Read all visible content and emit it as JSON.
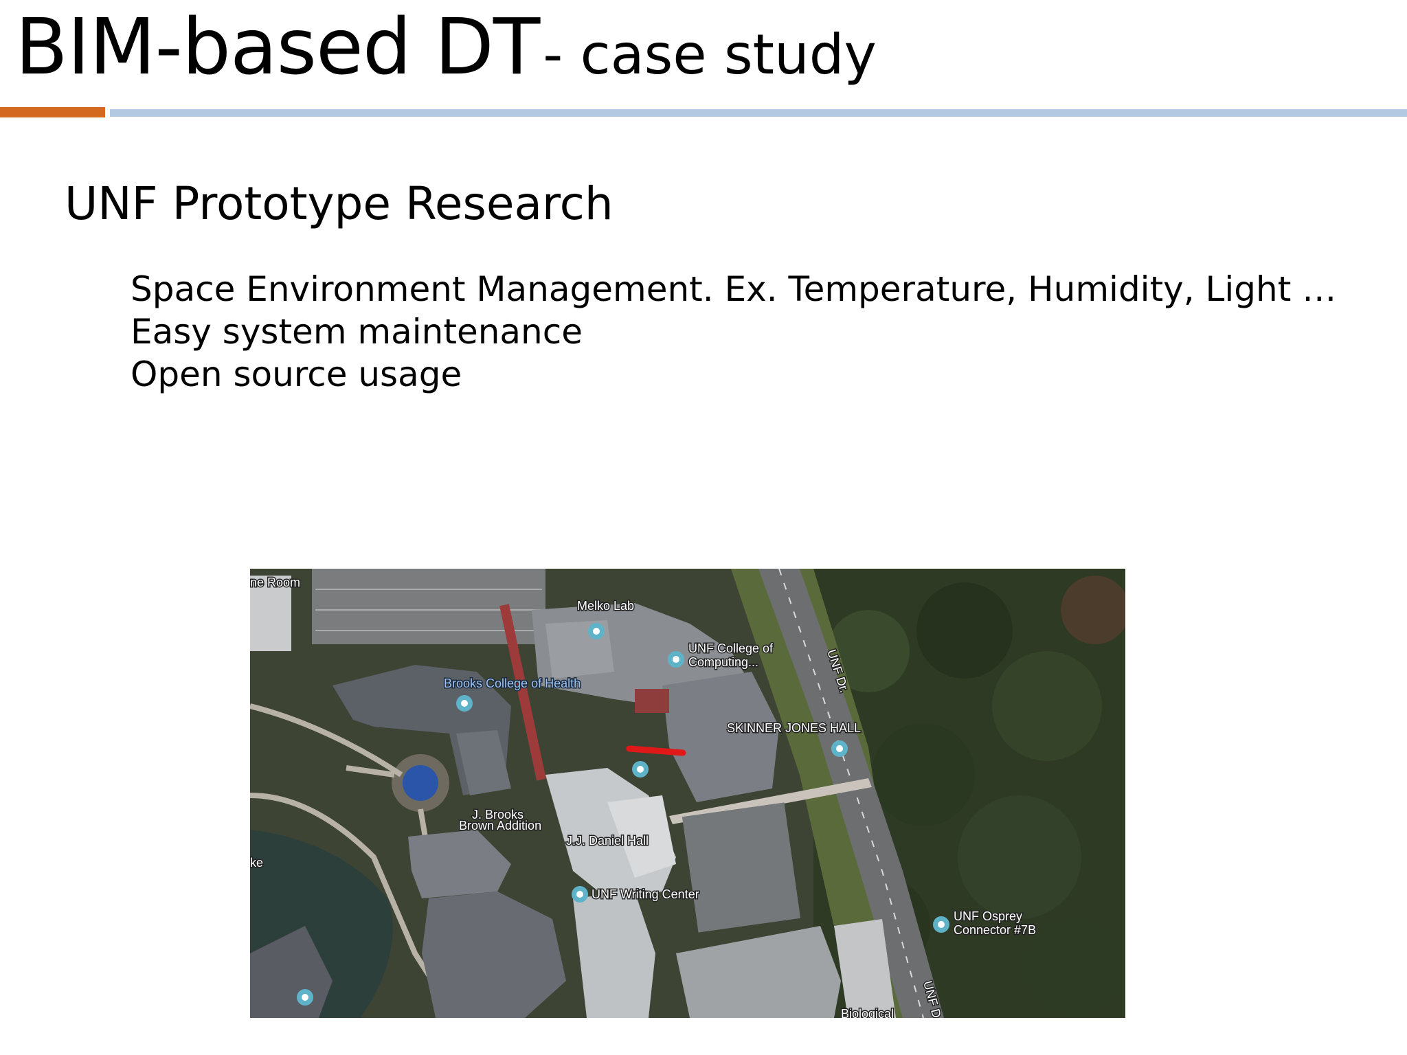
{
  "slide": {
    "title_main": "BIM-based DT",
    "title_sub": "- case study",
    "heading": "UNF Prototype Research",
    "bullets": [
      "Space Environment Management. Ex. Temperature, Humidity, Light …",
      "Easy system maintenance",
      "Open source usage"
    ]
  },
  "map": {
    "labels": {
      "room_fragment": "ne Room",
      "melko_lab": "Melko Lab",
      "computing_line1": "UNF College of",
      "computing_line2": "Computing...",
      "unf_dr_top": "UNF Dr.",
      "brooks_health": "Brooks College of Health",
      "skinner_jones": "SKINNER JONES HALL",
      "brooks_brown_line1": "J. Brooks",
      "brooks_brown_line2": "Brown Addition",
      "jj_daniel": "J.J. Daniel Hall",
      "lake_fragment": "ke",
      "writing_center": "UNF Writing Center",
      "osprey_line1": "UNF Osprey",
      "osprey_line2": "Connector #7B",
      "unf_dr_bottom": "UNF D",
      "biological_fragment": "Biological"
    },
    "colors": {
      "highlight": "#e01818",
      "forest": "#2e3a24",
      "roof": "#8a8e93",
      "road": "#6c6e70"
    }
  }
}
